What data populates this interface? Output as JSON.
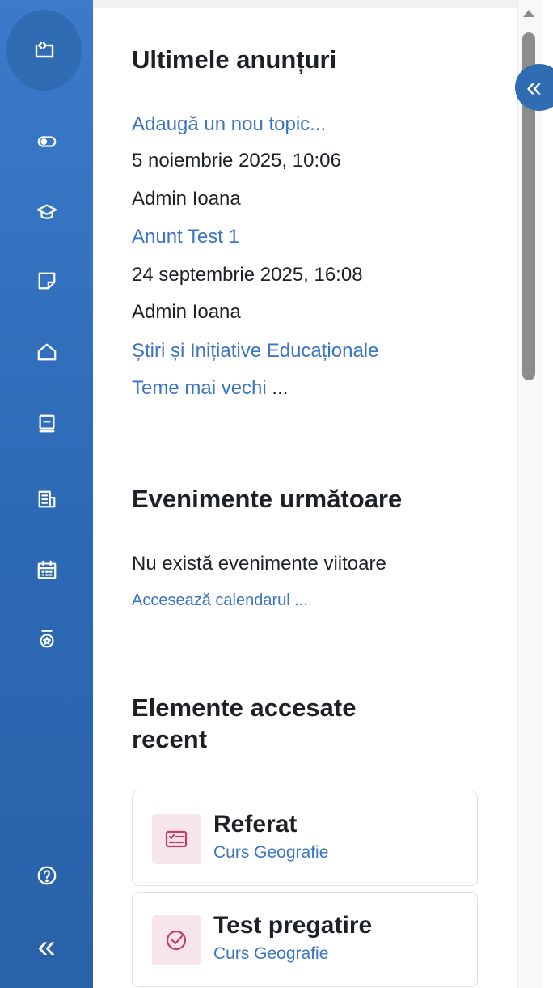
{
  "sidebar": {
    "icons": [
      {
        "name": "course-index-icon"
      },
      {
        "name": "toggle-icon"
      },
      {
        "name": "graduation-cap-icon"
      },
      {
        "name": "note-icon"
      },
      {
        "name": "home-icon"
      },
      {
        "name": "book-icon"
      },
      {
        "name": "report-icon"
      },
      {
        "name": "calendar-icon"
      },
      {
        "name": "badge-icon"
      },
      {
        "name": "help-icon"
      },
      {
        "name": "collapse-icon"
      }
    ],
    "collapse_glyph": "«"
  },
  "drawer": {
    "glyph": "«"
  },
  "announcements": {
    "title": "Ultimele anunțuri",
    "lines": [
      {
        "text": "Adaugă un nou topic...",
        "type": "link"
      },
      {
        "text": "5 noiembrie 2025, 10:06",
        "type": "text"
      },
      {
        "text": "Admin Ioana",
        "type": "text"
      },
      {
        "text": "Anunt Test 1",
        "type": "link"
      },
      {
        "text": "24 septembrie 2025, 16:08",
        "type": "text"
      },
      {
        "text": "Admin Ioana",
        "type": "text"
      },
      {
        "text": "Știri și Inițiative Educaționale",
        "type": "link"
      }
    ],
    "older_link": "Teme mai vechi",
    "older_suffix": " ..."
  },
  "events": {
    "title": "Evenimente următoare",
    "empty_text": "Nu există evenimente viitoare",
    "calendar_link": "Accesează calendarul ..."
  },
  "recent": {
    "title_line1": "Elemente accesate",
    "title_line2": "recent",
    "items": [
      {
        "title": "Referat",
        "course": "Curs Geografie",
        "icon": "assignment-icon"
      },
      {
        "title": "Test pregatire",
        "course": "Curs Geografie",
        "icon": "quiz-icon"
      }
    ]
  },
  "colors": {
    "sidebar": "#2c69b5",
    "link": "#3b74c4",
    "activity_icon": "#c43b6a",
    "activity_icon_bg": "#f6e6ea"
  }
}
